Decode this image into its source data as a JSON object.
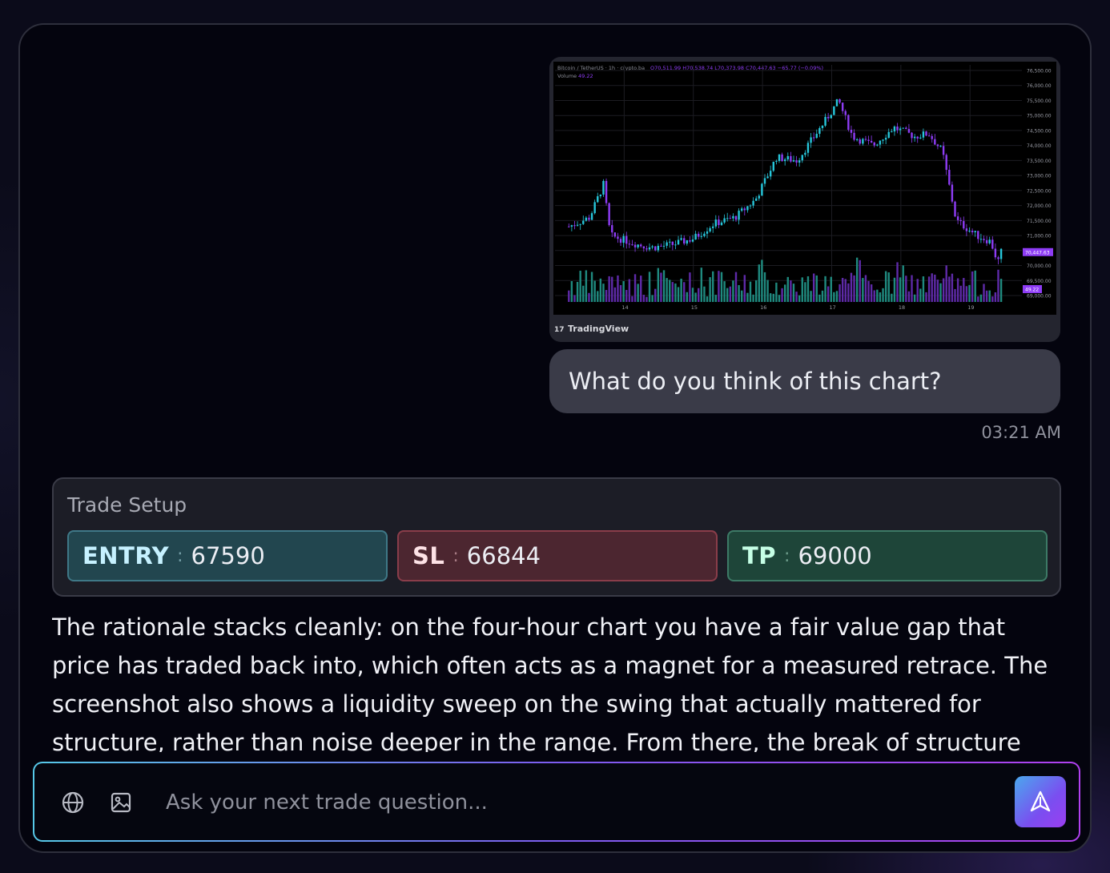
{
  "chat": {
    "user_message": {
      "text": "What do you think of this chart?",
      "timestamp": "03:21 AM",
      "attachment": {
        "header_symbol": "Bitcoin / TetherUS · 1h · crypto.ba",
        "header_ohlc": "O70,511.99 H70,538.74 L70,373.98 C70,447.63 −65.77 (−0.09%)",
        "volume_label": "Volume",
        "volume_value": "49.22",
        "watermark": "TradingView",
        "last_price_tag": "70,447.63",
        "last_volume_tag": "49.22",
        "colors": {
          "up": "#26c6da",
          "down": "#8e3cf5",
          "background": "#000000"
        },
        "chart_data": {
          "type": "candlestick",
          "symbol": "Bitcoin / TetherUS",
          "interval": "1h",
          "x_tick_labels": [
            "14",
            "15",
            "16",
            "17",
            "18",
            "19"
          ],
          "y_tick_labels": [
            "76,500.00",
            "76,000.00",
            "75,500.00",
            "75,000.00",
            "74,500.00",
            "74,000.00",
            "73,500.00",
            "73,000.00",
            "72,500.00",
            "72,000.00",
            "71,500.00",
            "71,000.00",
            "70,500.00",
            "70,000.00",
            "69,500.00",
            "69,000.00"
          ],
          "ylim": [
            69000,
            76500
          ],
          "grid": true,
          "approx_close_path": [
            {
              "x": "13.2",
              "y": 71300
            },
            {
              "x": "13.5",
              "y": 71600
            },
            {
              "x": "13.7",
              "y": 72700
            },
            {
              "x": "13.8",
              "y": 71000
            },
            {
              "x": "14.2",
              "y": 70700
            },
            {
              "x": "14.4",
              "y": 70600
            },
            {
              "x": "14.7",
              "y": 70700
            },
            {
              "x": "15.0",
              "y": 70900
            },
            {
              "x": "15.3",
              "y": 71400
            },
            {
              "x": "15.6",
              "y": 71600
            },
            {
              "x": "15.9",
              "y": 72200
            },
            {
              "x": "16.2",
              "y": 73600
            },
            {
              "x": "16.5",
              "y": 73500
            },
            {
              "x": "16.9",
              "y": 74800
            },
            {
              "x": "17.1",
              "y": 75500
            },
            {
              "x": "17.3",
              "y": 74300
            },
            {
              "x": "17.6",
              "y": 74000
            },
            {
              "x": "17.9",
              "y": 74600
            },
            {
              "x": "18.2",
              "y": 74300
            },
            {
              "x": "18.4",
              "y": 74400
            },
            {
              "x": "18.6",
              "y": 73800
            },
            {
              "x": "18.8",
              "y": 71500
            },
            {
              "x": "19.1",
              "y": 71000
            },
            {
              "x": "19.3",
              "y": 70800
            },
            {
              "x": "19.4",
              "y": 70100
            },
            {
              "x": "19.45",
              "y": 70447.63
            }
          ]
        }
      }
    },
    "trade_setup": {
      "title": "Trade Setup",
      "entry": {
        "label": "ENTRY",
        "separator": ":",
        "value": "67590"
      },
      "sl": {
        "label": "SL",
        "separator": ":",
        "value": "66844"
      },
      "tp": {
        "label": "TP",
        "separator": ":",
        "value": "69000"
      }
    },
    "rationale": "The rationale stacks cleanly: on the four-hour chart you have a fair value gap that price has traded back into, which often acts as a magnet for a measured retrace. The screenshot also shows a liquidity sweep on the swing that actually mattered for structure, rather than noise deeper in the range. From there, the break of structure aligns with how"
  },
  "composer": {
    "placeholder": "Ask your next trade question...",
    "icons": {
      "web": "globe-icon",
      "image": "image-icon",
      "send": "send-arrow-icon"
    }
  }
}
